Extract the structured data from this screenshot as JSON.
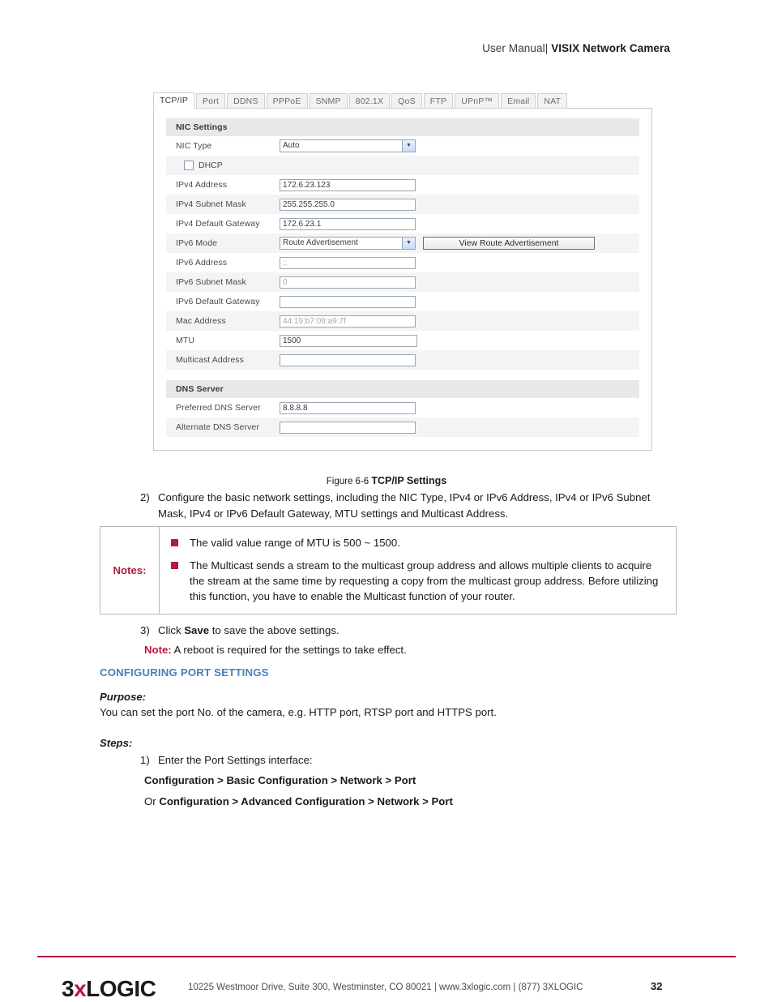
{
  "header": {
    "prefix": "User Manual| ",
    "title": "VISIX Network Camera"
  },
  "figure": {
    "tabs": [
      {
        "label": "TCP/IP",
        "active": true
      },
      {
        "label": "Port",
        "active": false
      },
      {
        "label": "DDNS",
        "active": false
      },
      {
        "label": "PPPoE",
        "active": false
      },
      {
        "label": "SNMP",
        "active": false
      },
      {
        "label": "802.1X",
        "active": false
      },
      {
        "label": "QoS",
        "active": false
      },
      {
        "label": "FTP",
        "active": false
      },
      {
        "label": "UPnP™",
        "active": false
      },
      {
        "label": "Email",
        "active": false
      },
      {
        "label": "NAT",
        "active": false
      }
    ],
    "nic_section": {
      "title": "NIC Settings",
      "nic_type_label": "NIC Type",
      "nic_type_value": "Auto",
      "dhcp_label": "DHCP",
      "dhcp_checked": false,
      "rows": [
        {
          "label": "IPv4 Address",
          "value": "172.6.23.123",
          "dim": false
        },
        {
          "label": "IPv4 Subnet Mask",
          "value": "255.255.255.0",
          "dim": false
        },
        {
          "label": "IPv4 Default Gateway",
          "value": "172.6.23.1",
          "dim": false
        }
      ],
      "ipv6_mode_label": "IPv6 Mode",
      "ipv6_mode_value": "Route Advertisement",
      "view_route_button": "View Route Advertisement",
      "rows2": [
        {
          "label": "IPv6 Address",
          "value": "::",
          "dim": true
        },
        {
          "label": "IPv6 Subnet Mask",
          "value": "0",
          "dim": true
        },
        {
          "label": "IPv6 Default Gateway",
          "value": "",
          "dim": false
        },
        {
          "label": "Mac Address",
          "value": "44:19:b7:09:a9:7f",
          "dim": true
        },
        {
          "label": "MTU",
          "value": "1500",
          "dim": false
        },
        {
          "label": "Multicast Address",
          "value": "",
          "dim": false
        }
      ]
    },
    "dns_section": {
      "title": "DNS Server",
      "rows": [
        {
          "label": "Preferred DNS Server",
          "value": "8.8.8.8",
          "dim": false
        },
        {
          "label": "Alternate DNS Server",
          "value": "",
          "dim": false
        }
      ]
    }
  },
  "caption": {
    "figure_no": "Figure 6-6 ",
    "title": "TCP/IP Settings"
  },
  "steps": {
    "step2_num": "2)",
    "step2_text": "Configure the basic network settings, including the NIC Type, IPv4 or IPv6 Address, IPv4 or IPv6 Subnet Mask, IPv4 or IPv6 Default Gateway, MTU settings and Multicast Address.",
    "step3_num": "3)",
    "step3_pre": "Click ",
    "step3_bold": "Save",
    "step3_post": " to save the above settings.",
    "step1_num": "1)",
    "step1_text": "Enter the Port Settings interface:"
  },
  "notes": {
    "label": "Notes:",
    "items": [
      "The valid value range of MTU is 500 ~ 1500.",
      "The Multicast sends a stream to the multicast group address and allows multiple clients to acquire the stream at the same time by requesting a copy from the multicast group address. Before utilizing this function, you have to enable the Multicast function of your router."
    ]
  },
  "note_line": {
    "label": "Note:",
    "text": " A reboot is required for the settings to take effect."
  },
  "section": {
    "heading": "CONFIGURING PORT SETTINGS",
    "purpose_label": "Purpose:",
    "purpose_text": "You can set the port No. of the camera, e.g. HTTP port, RTSP port and HTTPS port.",
    "steps_label": "Steps:",
    "path1": "Configuration > Basic Configuration > Network > Port",
    "path2_or": "Or ",
    "path2": "Configuration > Advanced Configuration > Network > Port"
  },
  "footer": {
    "logo_a": "3",
    "logo_x": "x",
    "logo_b": "LOGIC",
    "text": "10225 Westmoor Drive, Suite 300, Westminster, CO 80021 | www.3xlogic.com | (877) 3XLOGIC",
    "page": "32"
  },
  "colors": {
    "accent_red": "#b01b3e",
    "heading_blue": "#4a7ebb",
    "note_red": "#c0143c"
  }
}
